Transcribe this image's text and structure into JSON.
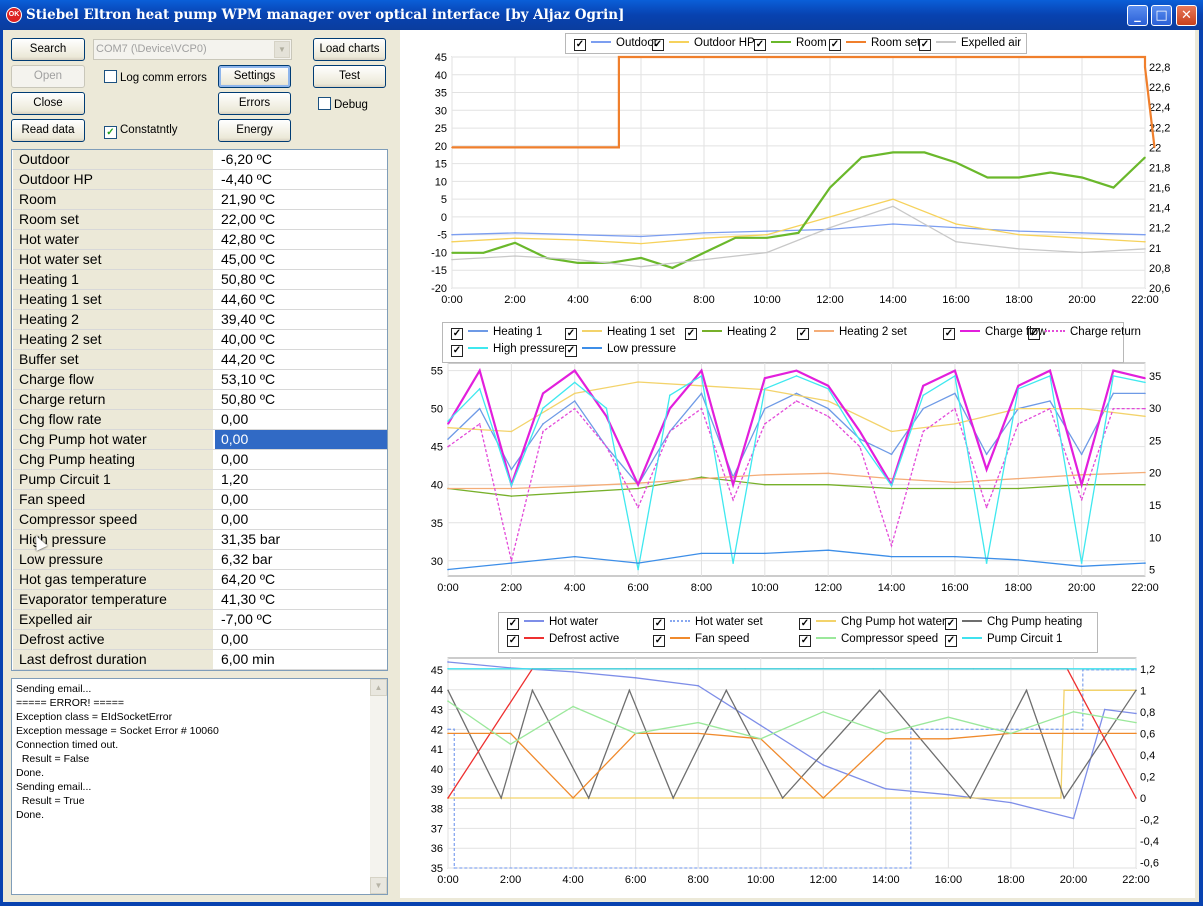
{
  "window": {
    "title": "Stiebel Eltron heat pump WPM manager over optical interface [by Aljaz Ogrin]",
    "icon_text": "OK",
    "minimize_glyph": "_",
    "maximize_glyph": "□",
    "close_glyph": "✕"
  },
  "controls": {
    "search": "Search",
    "port": "COM7 (\\Device\\VCP0)",
    "load_charts": "Load charts",
    "open": "Open",
    "log_comm_errors": "Log comm errors",
    "settings": "Settings",
    "test": "Test",
    "close": "Close",
    "errors": "Errors",
    "debug": "Debug",
    "read_data": "Read data",
    "constantly": "Constatntly",
    "energy": "Energy",
    "log_comm_errors_checked": false,
    "debug_checked": false,
    "constantly_checked": true
  },
  "readings": [
    {
      "name": "Outdoor",
      "value": "-6,20 ºC"
    },
    {
      "name": "Outdoor HP",
      "value": "-4,40 ºC"
    },
    {
      "name": "Room",
      "value": "21,90 ºC"
    },
    {
      "name": "Room set",
      "value": "22,00 ºC"
    },
    {
      "name": "Hot water",
      "value": "42,80 ºC"
    },
    {
      "name": "Hot water set",
      "value": "45,00 ºC"
    },
    {
      "name": "Heating 1",
      "value": "50,80 ºC"
    },
    {
      "name": "Heating 1 set",
      "value": "44,60 ºC"
    },
    {
      "name": "Heating 2",
      "value": "39,40 ºC"
    },
    {
      "name": "Heating 2 set",
      "value": "40,00 ºC"
    },
    {
      "name": "Buffer set",
      "value": "44,20 ºC"
    },
    {
      "name": "Charge flow",
      "value": "53,10 ºC"
    },
    {
      "name": "Charge return",
      "value": "50,80 ºC"
    },
    {
      "name": "Chg flow rate",
      "value": "0,00"
    },
    {
      "name": "Chg Pump hot water",
      "value": "0,00",
      "selected": true
    },
    {
      "name": "Chg Pump heating",
      "value": "0,00"
    },
    {
      "name": "Pump Circuit 1",
      "value": "1,20"
    },
    {
      "name": "Fan speed",
      "value": "0,00"
    },
    {
      "name": "Compressor speed",
      "value": "0,00"
    },
    {
      "name": "High pressure",
      "value": "31,35 bar"
    },
    {
      "name": "Low pressure",
      "value": "6,32 bar"
    },
    {
      "name": "Hot gas temperature",
      "value": "64,20 ºC"
    },
    {
      "name": "Evaporator temperature",
      "value": "41,30 ºC"
    },
    {
      "name": "Expelled air",
      "value": "-7,00 ºC"
    },
    {
      "name": "Defrost active",
      "value": "0,00"
    },
    {
      "name": "Last defrost duration",
      "value": "6,00 min"
    }
  ],
  "log": [
    "Sending email...",
    "===== ERROR! =====",
    "Exception class = EIdSocketError",
    "Exception message = Socket Error # 10060",
    "Connection timed out.",
    "  Result = False",
    "Done.",
    "Sending email...",
    "  Result = True",
    "Done."
  ],
  "chart_data": [
    {
      "type": "line",
      "x_ticks": [
        "0:00",
        "2:00",
        "4:00",
        "6:00",
        "8:00",
        "10:00",
        "12:00",
        "14:00",
        "16:00",
        "18:00",
        "20:00",
        "22:00"
      ],
      "ylim": [
        -20,
        45
      ],
      "y_ticks": [
        "45",
        "40",
        "35",
        "30",
        "25",
        "20",
        "15",
        "10",
        "5",
        "0",
        "-5",
        "-10",
        "-15",
        "-20"
      ],
      "y2lim": [
        20.6,
        22.9
      ],
      "y2_ticks": [
        "22,8",
        "22,6",
        "22,4",
        "22,2",
        "22",
        "21,8",
        "21,6",
        "21,4",
        "21,2",
        "21",
        "20,8",
        "20,6"
      ],
      "grid": true,
      "legend_position": "top",
      "series": [
        {
          "name": "Outdoor",
          "color": "#7c9ef0",
          "axis": "left",
          "x": [
            0,
            2,
            4,
            6,
            8,
            10,
            12,
            14,
            16,
            18,
            20,
            22
          ],
          "values": [
            -5,
            -4.5,
            -5,
            -5.5,
            -4.5,
            -4,
            -3.5,
            -2,
            -3,
            -4,
            -4.5,
            -5
          ]
        },
        {
          "name": "Outdoor HP",
          "color": "#f6d25c",
          "axis": "left",
          "x": [
            0,
            2,
            4,
            6,
            8,
            10,
            12,
            14,
            16,
            18,
            20,
            22
          ],
          "values": [
            -7,
            -6,
            -6.5,
            -7.5,
            -6,
            -5,
            0,
            5,
            -2,
            -5,
            -6,
            -7
          ]
        },
        {
          "name": "Room",
          "color": "#6ab82b",
          "axis": "right",
          "x": [
            0,
            1,
            2,
            3,
            4,
            5,
            6,
            7,
            8,
            9,
            10,
            11,
            12,
            13,
            14,
            15,
            16,
            17,
            18,
            19,
            20,
            21,
            22
          ],
          "values": [
            20.95,
            20.95,
            21.05,
            20.9,
            20.85,
            20.85,
            20.9,
            20.8,
            20.95,
            21.1,
            21.1,
            21.15,
            21.6,
            21.9,
            21.95,
            21.95,
            21.85,
            21.7,
            21.7,
            21.75,
            21.7,
            21.6,
            21.9
          ]
        },
        {
          "name": "Room set",
          "color": "#f07f2c",
          "axis": "right",
          "x": [
            0,
            5.3,
            5.3,
            22,
            22,
            22.3
          ],
          "values": [
            22.0,
            22.0,
            22.9,
            22.9,
            22.8,
            22.0
          ]
        },
        {
          "name": "Expelled air",
          "color": "#c8c8c8",
          "axis": "left",
          "x": [
            0,
            2,
            4,
            6,
            8,
            10,
            12,
            14,
            16,
            18,
            20,
            22
          ],
          "values": [
            -12,
            -11,
            -12,
            -14,
            -12,
            -10,
            -3,
            3,
            -7,
            -9,
            -10,
            -9
          ]
        }
      ]
    },
    {
      "type": "line",
      "x_ticks": [
        "0:00",
        "2:00",
        "4:00",
        "6:00",
        "8:00",
        "10:00",
        "12:00",
        "14:00",
        "16:00",
        "18:00",
        "20:00",
        "22:00"
      ],
      "ylim": [
        28,
        56
      ],
      "y_ticks": [
        "55",
        "50",
        "45",
        "40",
        "35",
        "30"
      ],
      "y2lim": [
        4,
        37
      ],
      "y2_ticks": [
        "35",
        "30",
        "25",
        "20",
        "15",
        "10",
        "5"
      ],
      "grid": true,
      "legend_position": "top",
      "series": [
        {
          "name": "Heating 1",
          "color": "#6e9ae6",
          "axis": "left",
          "x": [
            0,
            1,
            2,
            3,
            4,
            5,
            6,
            7,
            8,
            9,
            10,
            11,
            12,
            13,
            14,
            15,
            16,
            17,
            18,
            19,
            20,
            21,
            22
          ],
          "values": [
            46,
            50,
            42,
            48,
            51,
            45,
            40,
            47,
            52,
            41,
            50,
            52,
            50,
            46,
            44,
            50,
            52,
            44,
            50,
            51,
            44,
            52,
            52
          ]
        },
        {
          "name": "Heating 1 set",
          "color": "#f3d36b",
          "axis": "left",
          "x": [
            0,
            2,
            4,
            6,
            8,
            10,
            12,
            14,
            16,
            18,
            20,
            22
          ],
          "values": [
            47.5,
            47,
            52,
            53.5,
            53,
            52.5,
            51,
            47,
            48,
            50,
            50,
            49
          ]
        },
        {
          "name": "Heating 2",
          "color": "#77b02a",
          "axis": "left",
          "x": [
            0,
            2,
            4,
            6,
            8,
            10,
            12,
            14,
            16,
            18,
            20,
            22
          ],
          "values": [
            39.5,
            38.5,
            39,
            39.5,
            41,
            40,
            40,
            39.5,
            39.5,
            39.5,
            40,
            40
          ]
        },
        {
          "name": "Heating 2 set",
          "color": "#f4ad78",
          "axis": "left",
          "x": [
            0,
            2,
            4,
            6,
            8,
            10,
            12,
            14,
            16,
            18,
            20,
            22
          ],
          "values": [
            39.5,
            39.5,
            39.8,
            40.2,
            40.8,
            41.3,
            41.5,
            40.8,
            40.3,
            40.8,
            41.3,
            41.6
          ]
        },
        {
          "name": "Charge flow",
          "color": "#e21fdc",
          "axis": "left",
          "x": [
            0,
            1,
            2,
            3,
            4,
            5,
            6,
            7,
            8,
            9,
            10,
            11,
            12,
            13,
            14,
            15,
            16,
            17,
            18,
            19,
            20,
            21,
            22
          ],
          "values": [
            48,
            55,
            40,
            52,
            55,
            49,
            40,
            50,
            55,
            40,
            54,
            55,
            53,
            47,
            40,
            53,
            55,
            42,
            53,
            55,
            40,
            55,
            54
          ]
        },
        {
          "name": "Charge return",
          "color": "#e34ad9",
          "axis": "left",
          "x": [
            0,
            1,
            2,
            3,
            4,
            5,
            6,
            7,
            8,
            9,
            10,
            11,
            12,
            13,
            14,
            15,
            16,
            17,
            18,
            19,
            20,
            21,
            22
          ],
          "values": [
            45,
            48,
            30,
            47,
            50,
            45,
            37,
            47,
            50,
            38,
            48,
            51,
            49,
            45,
            32,
            47,
            50,
            37,
            48,
            50,
            38,
            50,
            50
          ]
        },
        {
          "name": "High pressure",
          "color": "#3fe8ef",
          "axis": "right",
          "x": [
            0,
            1,
            2,
            3,
            4,
            5,
            6,
            7,
            8,
            9,
            10,
            11,
            12,
            13,
            14,
            15,
            16,
            17,
            18,
            19,
            20,
            21,
            22
          ],
          "values": [
            28,
            33,
            18,
            30,
            34,
            30,
            5,
            32,
            35,
            6,
            33,
            35,
            33,
            25,
            18,
            32,
            35,
            6,
            33,
            35,
            6,
            35,
            34
          ]
        },
        {
          "name": "Low pressure",
          "color": "#3d8ee8",
          "axis": "right",
          "x": [
            0,
            2,
            4,
            6,
            8,
            10,
            12,
            14,
            16,
            18,
            20,
            22
          ],
          "values": [
            5,
            6,
            7,
            6,
            7.5,
            7.5,
            8,
            7,
            7,
            6.5,
            5.5,
            6
          ]
        }
      ]
    },
    {
      "type": "line",
      "x_ticks": [
        "0:00",
        "2:00",
        "4:00",
        "6:00",
        "8:00",
        "10:00",
        "12:00",
        "14:00",
        "16:00",
        "18:00",
        "20:00",
        "22:00"
      ],
      "ylim": [
        35,
        45.6
      ],
      "y_ticks": [
        "45",
        "44",
        "43",
        "42",
        "41",
        "40",
        "39",
        "38",
        "37",
        "36",
        "35"
      ],
      "y2lim": [
        -0.65,
        1.3
      ],
      "y2_ticks": [
        "1,2",
        "1",
        "0,8",
        "0,6",
        "0,4",
        "0,2",
        "0",
        "-0,2",
        "-0,4",
        "-0,6"
      ],
      "grid": true,
      "legend_position": "top",
      "series": [
        {
          "name": "Hot water",
          "color": "#7e8ee8",
          "axis": "left",
          "x": [
            0,
            2,
            4,
            6,
            8,
            10,
            12,
            14,
            16,
            18,
            20,
            21,
            22
          ],
          "values": [
            45.4,
            45.1,
            44.9,
            44.6,
            44.2,
            42.2,
            40.2,
            39.0,
            38.7,
            38.3,
            37.5,
            43,
            42.8
          ]
        },
        {
          "name": "Hot water set",
          "color": "#88a8f0",
          "axis": "left",
          "x": [
            0,
            0.2,
            0.2,
            14.8,
            14.8,
            20.3,
            20.3,
            22
          ],
          "values": [
            42,
            42,
            35,
            35,
            42,
            42,
            45,
            45
          ]
        },
        {
          "name": "Chg Pump hot water",
          "color": "#f3d36b",
          "axis": "right",
          "x": [
            0,
            19.6,
            19.7,
            20,
            22
          ],
          "values": [
            0,
            0,
            1,
            1,
            1
          ]
        },
        {
          "name": "Chg Pump heating",
          "color": "#6e6e6e",
          "axis": "right",
          "x": [
            0,
            1.7,
            2.7,
            4.5,
            5.8,
            7.2,
            8.9,
            10.7,
            13.8,
            16.7,
            18.5,
            19.7,
            22
          ],
          "values": [
            1,
            0,
            1,
            0,
            1,
            0,
            1,
            0,
            1,
            0,
            1,
            0,
            1
          ]
        },
        {
          "name": "Defrost active",
          "color": "#ee3030",
          "axis": "right",
          "x": [
            0,
            2.7,
            5.7,
            7.7,
            9.5,
            11.2,
            13.6,
            16.8,
            19.8,
            22
          ],
          "values": [
            0,
            1.2,
            1.2,
            1.2,
            1.2,
            1.2,
            1.2,
            1.2,
            1.2,
            0
          ]
        },
        {
          "name": "Fan speed",
          "color": "#f08a2c",
          "axis": "right",
          "x": [
            0,
            2,
            4,
            6,
            8,
            10,
            12,
            14,
            16,
            18,
            20,
            22
          ],
          "values": [
            0.6,
            0.6,
            0,
            0.6,
            0.6,
            0.55,
            0,
            0.55,
            0.55,
            0.6,
            0.6,
            0.6
          ]
        },
        {
          "name": "Compressor speed",
          "color": "#9be89b",
          "axis": "right",
          "x": [
            0,
            2,
            4,
            6,
            8,
            10,
            12,
            14,
            16,
            18,
            20,
            22
          ],
          "values": [
            0.9,
            0.5,
            0.85,
            0.6,
            0.7,
            0.55,
            0.8,
            0.6,
            0.75,
            0.6,
            0.8,
            0.7
          ]
        },
        {
          "name": "Pump Circuit 1",
          "color": "#3fe2ef",
          "axis": "right",
          "x": [
            0,
            22
          ],
          "values": [
            1.2,
            1.2
          ]
        }
      ]
    }
  ]
}
